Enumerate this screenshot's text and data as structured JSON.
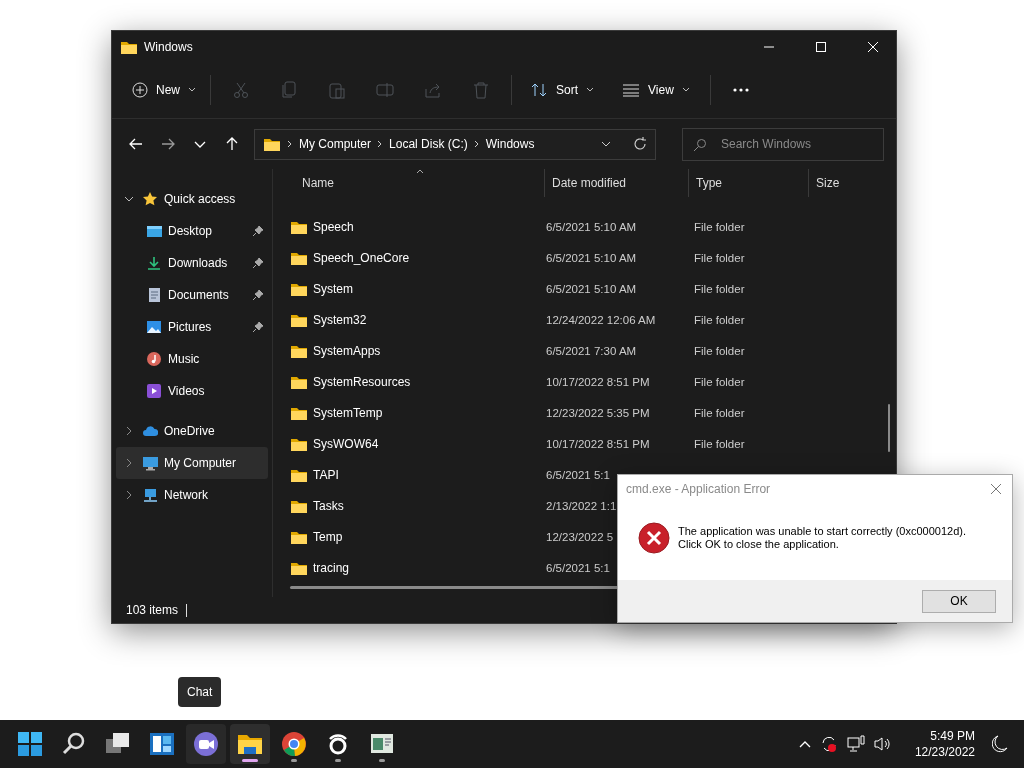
{
  "window": {
    "title": "Windows"
  },
  "toolbar": {
    "new_label": "New",
    "actions": [
      {
        "kind": "cut",
        "disabled": true
      },
      {
        "kind": "copy",
        "disabled": true
      },
      {
        "kind": "paste",
        "disabled": true
      },
      {
        "kind": "rename",
        "disabled": true
      },
      {
        "kind": "share",
        "disabled": true
      },
      {
        "kind": "delete",
        "disabled": true
      }
    ],
    "sort_label": "Sort",
    "view_label": "View"
  },
  "address": {
    "path": [
      "My Computer",
      "Local Disk (C:)",
      "Windows"
    ]
  },
  "search": {
    "placeholder": "Search Windows"
  },
  "sidebar": {
    "items": [
      {
        "label": "Quick access",
        "kind": "star",
        "expanded": true,
        "selected": false,
        "children": [
          {
            "label": "Desktop",
            "kind": "desktop",
            "pinned": true,
            "selected": false
          },
          {
            "label": "Downloads",
            "kind": "downloads",
            "pinned": true,
            "selected": false
          },
          {
            "label": "Documents",
            "kind": "documents",
            "pinned": true,
            "selected": false
          },
          {
            "label": "Pictures",
            "kind": "pictures",
            "pinned": true,
            "selected": false
          },
          {
            "label": "Music",
            "kind": "music",
            "pinned": false,
            "selected": false
          },
          {
            "label": "Videos",
            "kind": "videos",
            "pinned": false,
            "selected": false
          }
        ]
      },
      {
        "label": "OneDrive",
        "kind": "cloud",
        "expanded": false,
        "selected": false
      },
      {
        "label": "My Computer",
        "kind": "computer",
        "expanded": false,
        "selected": true
      },
      {
        "label": "Network",
        "kind": "network",
        "expanded": false,
        "selected": false
      }
    ]
  },
  "table": {
    "columns": [
      "Name",
      "Date modified",
      "Type",
      "Size"
    ],
    "rows": [
      {
        "name": "Speech",
        "date": "6/5/2021 5:10 AM",
        "type": "File folder"
      },
      {
        "name": "Speech_OneCore",
        "date": "6/5/2021 5:10 AM",
        "type": "File folder"
      },
      {
        "name": "System",
        "date": "6/5/2021 5:10 AM",
        "type": "File folder"
      },
      {
        "name": "System32",
        "date": "12/24/2022 12:06 AM",
        "type": "File folder"
      },
      {
        "name": "SystemApps",
        "date": "6/5/2021 7:30 AM",
        "type": "File folder"
      },
      {
        "name": "SystemResources",
        "date": "10/17/2022 8:51 PM",
        "type": "File folder"
      },
      {
        "name": "SystemTemp",
        "date": "12/23/2022 5:35 PM",
        "type": "File folder"
      },
      {
        "name": "SysWOW64",
        "date": "10/17/2022 8:51 PM",
        "type": "File folder"
      },
      {
        "name": "TAPI",
        "date": "6/5/2021 5:1"
      },
      {
        "name": "Tasks",
        "date": "2/13/2022 1:1"
      },
      {
        "name": "Temp",
        "date": "12/23/2022 5"
      },
      {
        "name": "tracing",
        "date": "6/5/2021 5:1"
      }
    ]
  },
  "status_bar": {
    "count": "103 items"
  },
  "dialog": {
    "title": "cmd.exe - Application Error",
    "message": [
      "The application was unable to start correctly (0xc000012d).",
      "Click OK to close the application."
    ],
    "button": "OK"
  },
  "tooltip": {
    "text": "Chat"
  },
  "taskbar": {
    "apps": [
      {
        "kind": "start",
        "running": false,
        "active": false,
        "hover": false
      },
      {
        "kind": "search",
        "running": false,
        "active": false,
        "hover": false
      },
      {
        "kind": "taskview",
        "running": false,
        "active": false,
        "hover": false
      },
      {
        "kind": "widgets",
        "running": false,
        "active": false,
        "hover": false
      },
      {
        "kind": "chat",
        "running": false,
        "active": false,
        "hover": true
      },
      {
        "kind": "explorer",
        "running": true,
        "active": true,
        "hover": false
      },
      {
        "kind": "browser",
        "running": true,
        "active": false,
        "hover": false
      },
      {
        "kind": "ring",
        "running": true,
        "active": false,
        "hover": false
      },
      {
        "kind": "monitor",
        "running": true,
        "active": false,
        "hover": false
      }
    ],
    "time": "5:49 PM",
    "date": "12/23/2022"
  }
}
